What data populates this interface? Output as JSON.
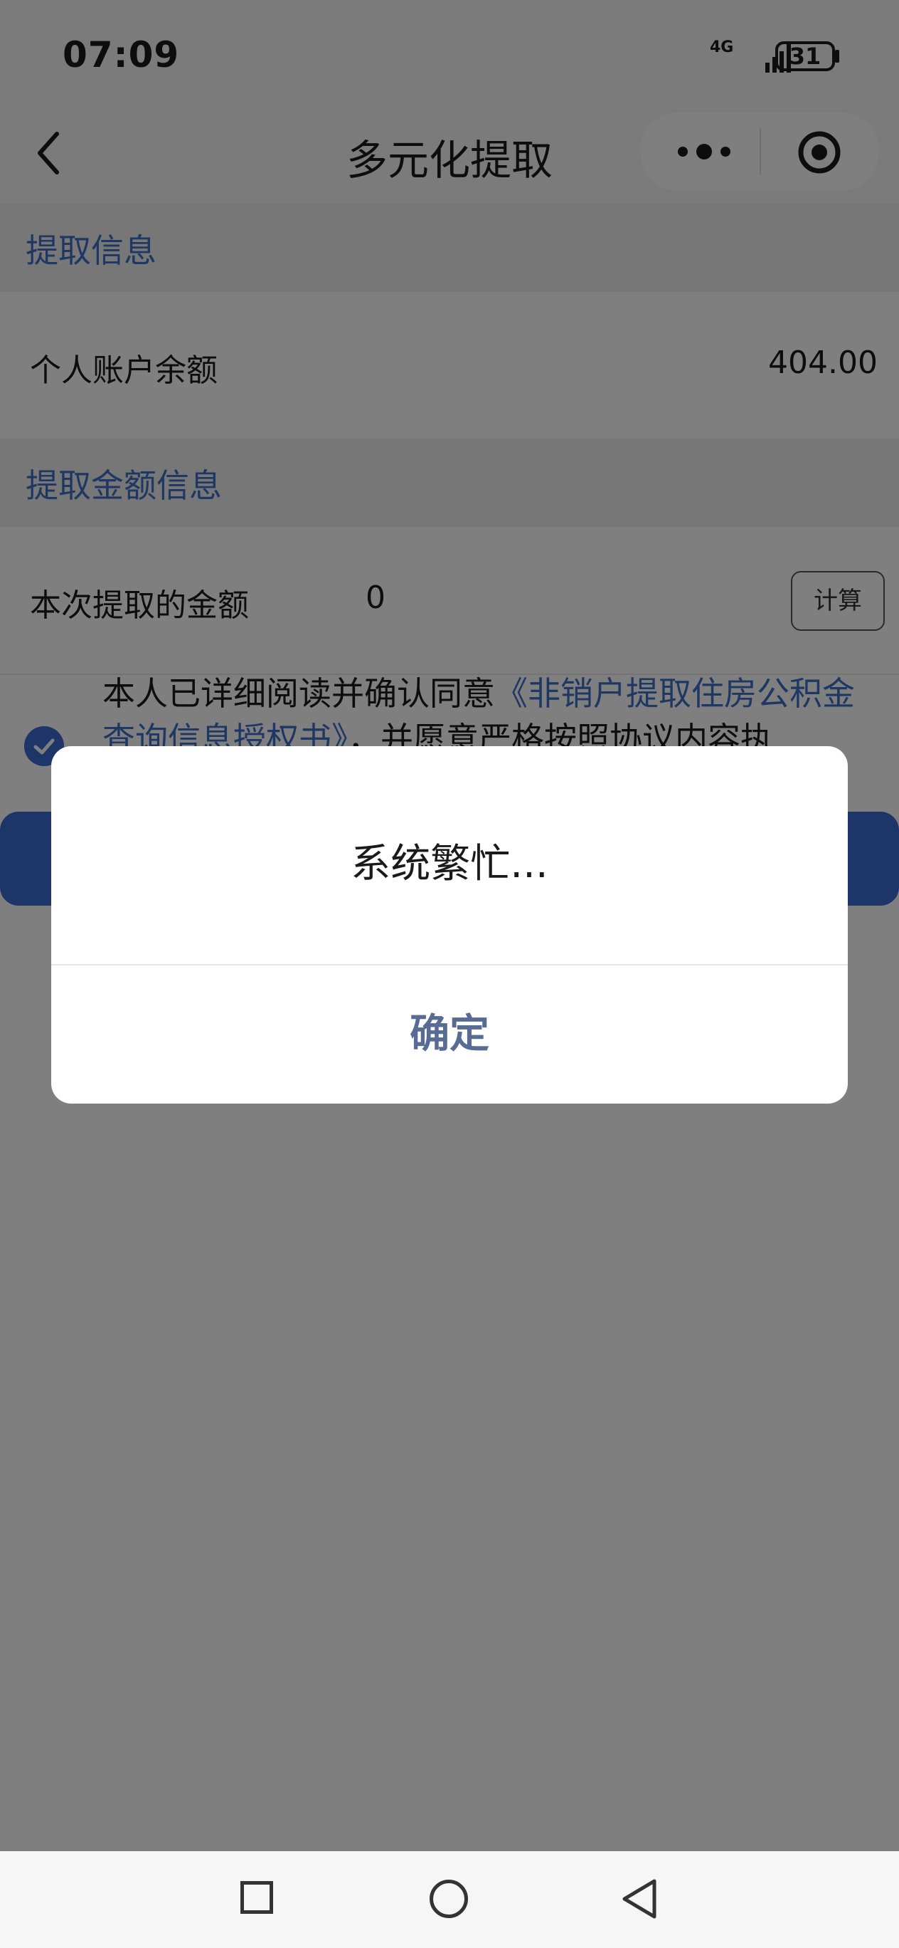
{
  "status_bar": {
    "time": "07:09",
    "network": "4G",
    "battery": "31"
  },
  "nav": {
    "title": "多元化提取"
  },
  "sections": {
    "info_title": "提取信息",
    "balance_label": "个人账户余额",
    "balance_value": "404.00",
    "amount_title": "提取金额信息",
    "amount_label": "本次提取的金额",
    "amount_value": "0",
    "calc_label": "计算"
  },
  "agreement": {
    "prefix": "本人已详细阅读并确认同意",
    "link": "《非销户提取住房公积金查询信息授权书》",
    "suffix": "，并愿意严格按照协议内容执"
  },
  "modal": {
    "message": "系统繁忙...",
    "ok_label": "确定"
  },
  "icons": {
    "back": "chevron-left-icon",
    "more": "more-dots-icon",
    "target": "target-icon",
    "check": "check-icon",
    "home": "circle-icon",
    "recents": "square-icon",
    "back_nav": "triangle-back-icon"
  },
  "colors": {
    "accent": "#3a6bd1",
    "section_title": "#3f6fc6",
    "modal_ok": "#576b95"
  }
}
